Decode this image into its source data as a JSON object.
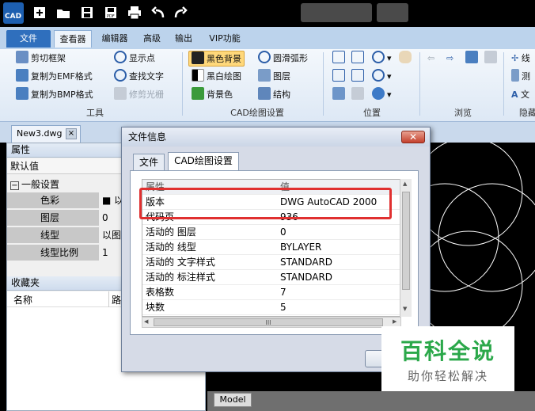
{
  "app": {
    "logo_text": "CAD"
  },
  "quick_toolbar": {
    "icons": [
      "new-icon",
      "open-icon",
      "save-icon",
      "save-as-pdf-icon",
      "print-icon",
      "undo-icon",
      "redo-icon"
    ]
  },
  "ribbon_tabs": [
    "文件",
    "查看器",
    "编辑器",
    "高级",
    "输出",
    "VIP功能"
  ],
  "ribbon": {
    "tools": {
      "label": "工具",
      "items": [
        "剪切框架",
        "复制为EMF格式",
        "复制为BMP格式",
        "显示点",
        "查找文字",
        "修剪光栅"
      ]
    },
    "cad_settings": {
      "label": "CAD绘图设置",
      "items": [
        "黑色背景",
        "黑白绘图",
        "背景色",
        "圆滑弧形",
        "图层",
        "结构"
      ]
    },
    "position": {
      "label": "位置"
    },
    "browse": {
      "label": "浏览"
    },
    "hidden": {
      "label": "隐藏",
      "items": [
        "线",
        "测",
        "文"
      ]
    }
  },
  "document_tab": {
    "name": "New3.dwg",
    "close": "×"
  },
  "properties_panel": {
    "title": "属性",
    "default_value_label": "默认值",
    "group": "一般设置",
    "rows": [
      {
        "name": "色彩",
        "value": "■ 以"
      },
      {
        "name": "图层",
        "value": "0"
      },
      {
        "name": "线型",
        "value": "以图层"
      },
      {
        "name": "线型比例",
        "value": "1"
      }
    ]
  },
  "favorites_panel": {
    "title": "收藏夹",
    "columns": [
      "名称",
      "路"
    ]
  },
  "model_tab": "Model",
  "dialog": {
    "title": "文件信息",
    "close": "✕",
    "tabs": [
      "文件",
      "CAD绘图设置"
    ],
    "grid_header": {
      "property": "属性",
      "value": "值"
    },
    "rows": [
      {
        "property": "版本",
        "value": "DWG AutoCAD 2000"
      },
      {
        "property": "代码页",
        "value": "936"
      },
      {
        "property": "活动的 图层",
        "value": "0"
      },
      {
        "property": "活动的 线型",
        "value": "BYLAYER"
      },
      {
        "property": "活动的 文字样式",
        "value": "STANDARD"
      },
      {
        "property": "活动的 标注样式",
        "value": "STANDARD"
      },
      {
        "property": "表格数",
        "value": "7"
      },
      {
        "property": "块数",
        "value": "5"
      }
    ],
    "hscroll_grip": "III"
  },
  "watermark": {
    "title": "百科全说",
    "subtitle": "助你轻松解决"
  },
  "colors": {
    "accent": "#2f6fbd",
    "highlight": "#e03030",
    "watermark_green": "#2ba84a"
  }
}
